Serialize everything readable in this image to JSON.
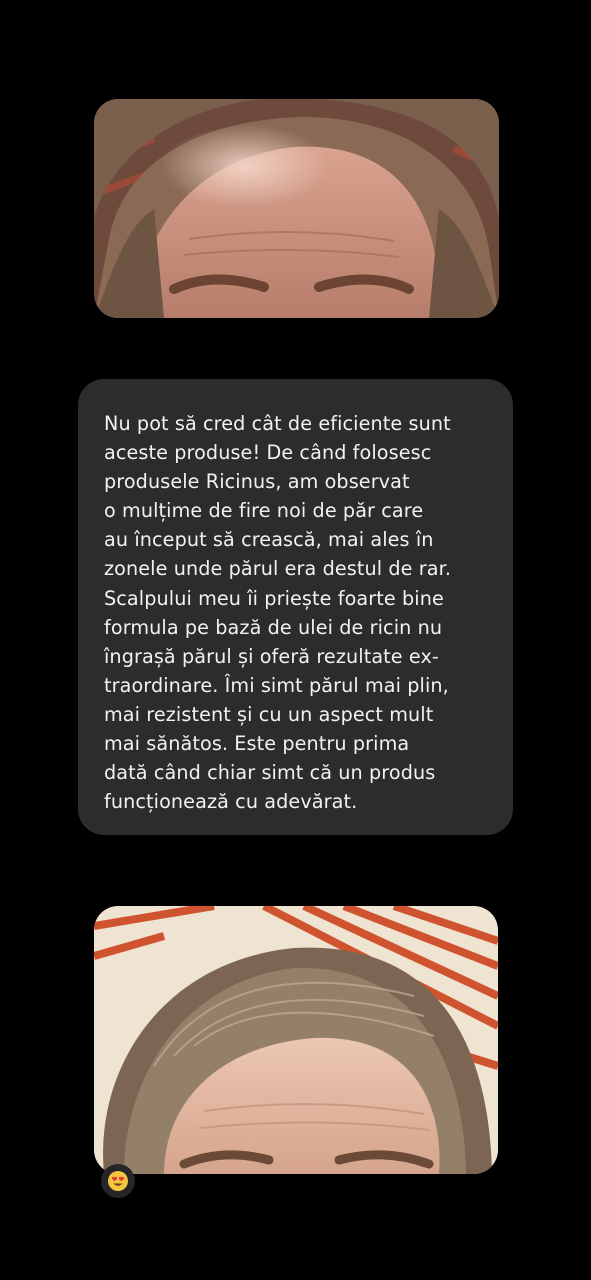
{
  "message": {
    "text": "Nu pot să cred cât de eficiente sunt\naceste produse! De când folosesc\nprodusele Ricinus, am observat\no mulțime de fire noi de păr care\nau început să crească, mai ales în\nzonele unde părul era destul de rar.\nScalpului meu îi priește foarte bine\nformula pe bază de ulei de ricin  nu\nîngrașă părul și oferă rezultate ex-\ntraordinare. Îmi simt părul mai plin,\nmai rezistent și cu un aspect mult\nmai sănătos. Este pentru prima\ndată când chiar simt că un produs\nfuncționează cu adevărat."
  },
  "photos": {
    "before": {
      "icon": "forehead-hairline-photo-before"
    },
    "after": {
      "icon": "forehead-hairline-photo-after"
    }
  },
  "reaction": {
    "icon": "heart-eyes-emoji-icon"
  },
  "colors": {
    "background": "#000000",
    "bubble": "#2c2c2e",
    "text": "#f2f2f2",
    "stripe": "#d0532f"
  }
}
